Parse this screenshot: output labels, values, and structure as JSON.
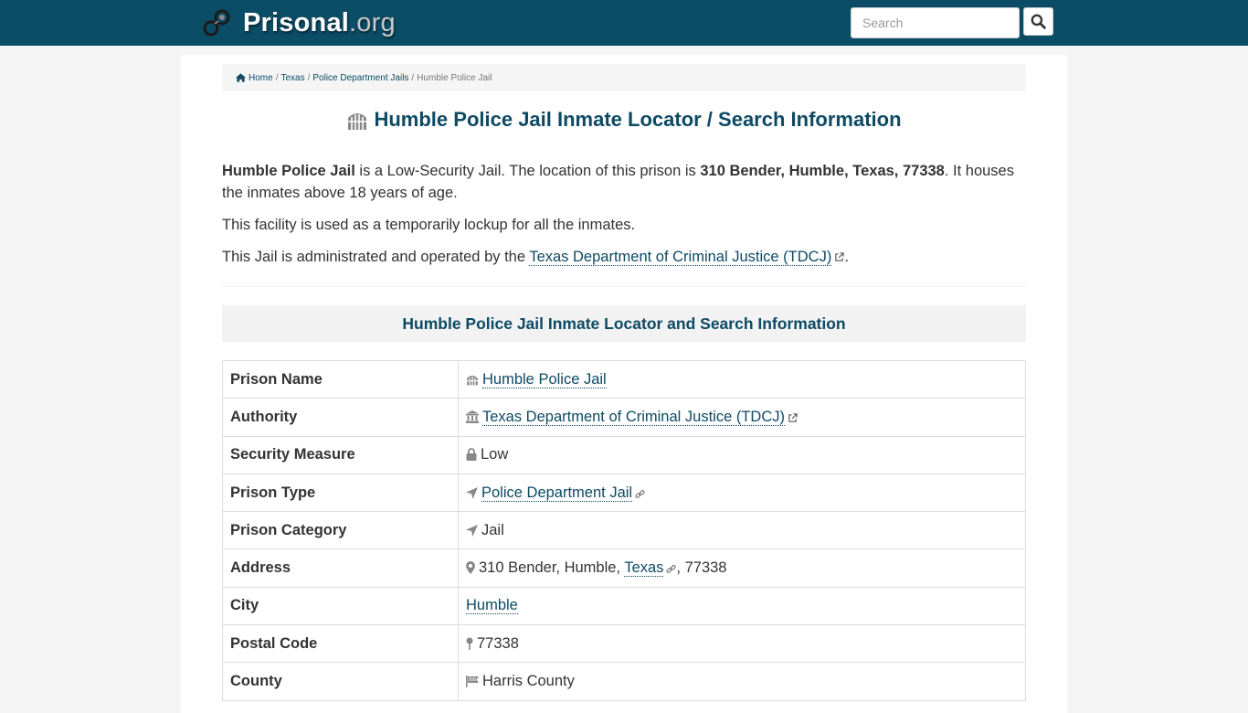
{
  "header": {
    "brand_name": "Prisonal",
    "brand_tld": ".org",
    "search_placeholder": "Search"
  },
  "breadcrumb": {
    "items": [
      "Home",
      "Texas",
      "Police Department Jails"
    ],
    "current": "Humble Police Jail"
  },
  "page": {
    "title": "Humble Police Jail Inmate Locator / Search Information",
    "intro": {
      "p1_name": "Humble Police Jail",
      "p1_mid": " is a Low-Security Jail. The location of this prison is ",
      "p1_address": "310 Bender, Humble, Texas, 77338",
      "p1_end": ". It houses the inmates above 18 years of age.",
      "p2": "This facility is used as a temporarily lockup for all the inmates.",
      "p3_start": "This Jail is administrated and operated by the ",
      "p3_link": "Texas Department of Criminal Justice (TDCJ)",
      "p3_end": "."
    },
    "section_title": "Humble Police Jail Inmate Locator and Search Information"
  },
  "info_table": {
    "prison_name": {
      "label": "Prison Name",
      "value": "Humble Police Jail",
      "icon": "jail-icon"
    },
    "authority": {
      "label": "Authority",
      "value": "Texas Department of Criminal Justice (TDCJ)",
      "icon": "institution-icon"
    },
    "security": {
      "label": "Security Measure",
      "value": "Low",
      "icon": "lock-icon"
    },
    "prison_type": {
      "label": "Prison Type",
      "value": "Police Department Jail",
      "icon": "location-arrow-icon"
    },
    "prison_category": {
      "label": "Prison Category",
      "value": "Jail",
      "icon": "location-arrow-icon"
    },
    "address": {
      "label": "Address",
      "street_city": "310 Bender, Humble, ",
      "state": "Texas",
      "zip_part": ", 77338",
      "icon": "map-marker-icon"
    },
    "city": {
      "label": "City",
      "value": "Humble"
    },
    "postal_code": {
      "label": "Postal Code",
      "value": "77338",
      "icon": "map-pin-icon"
    },
    "county": {
      "label": "County",
      "value": "Harris County",
      "icon": "flag-icon"
    }
  },
  "colors": {
    "navbar": "#0b4c66",
    "link": "#0d4a63",
    "title": "#0d4a63"
  }
}
